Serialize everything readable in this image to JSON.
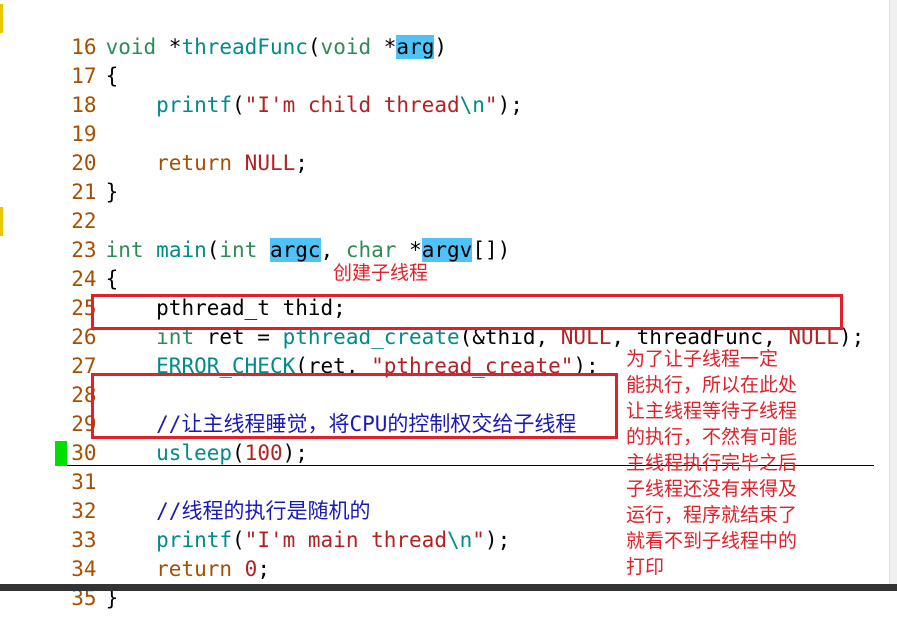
{
  "editor": {
    "lines": [
      {
        "n": "16"
      },
      {
        "n": "17"
      },
      {
        "n": "18"
      },
      {
        "n": "19"
      },
      {
        "n": "20"
      },
      {
        "n": "21"
      },
      {
        "n": "22"
      },
      {
        "n": "23"
      },
      {
        "n": "24"
      },
      {
        "n": "25"
      },
      {
        "n": "26"
      },
      {
        "n": "27"
      },
      {
        "n": "28"
      },
      {
        "n": "29"
      },
      {
        "n": "30"
      },
      {
        "n": "31"
      },
      {
        "n": "32"
      },
      {
        "n": "33"
      },
      {
        "n": "34"
      },
      {
        "n": "35"
      }
    ],
    "code": {
      "l16": {
        "a": "void",
        "b": " *",
        "c": "threadFunc",
        "d": "(",
        "e": "void",
        "f": " *",
        "g": "arg",
        "h": ")"
      },
      "l17": "{",
      "l18": {
        "fn": "printf",
        "open": "(",
        "s1": "\"I'm child thread",
        "esc": "\\n",
        "s2": "\"",
        "close": ");"
      },
      "l20": {
        "kw": "return",
        "sp": " ",
        "null": "NULL",
        "end": ";"
      },
      "l21": "}",
      "l23": {
        "t1": "int",
        "sp1": " ",
        "fn": "main",
        "p1": "(",
        "t2": "int",
        "sp2": " ",
        "a1": "argc",
        "c1": ", ",
        "t3": "char",
        "sp3": " *",
        "a2": "argv",
        "end": "[])"
      },
      "l24": "{",
      "l25": "pthread_t thid;",
      "l26": {
        "t": "int",
        "mid": " ret = ",
        "fn": "pthread_create",
        "a": "(&thid, ",
        "n1": "NULL",
        "b": ", threadFunc, ",
        "n2": "NULL",
        "end": ");"
      },
      "l27": {
        "m": "ERROR_CHECK",
        "a": "(ret, ",
        "s": "\"pthread_create\"",
        "end": ");"
      },
      "l29": "//让主线程睡觉，将CPU的控制权交给子线程",
      "l30": {
        "fn": "usleep",
        "a": "(",
        "num": "100",
        "end": ");"
      },
      "l32": "//线程的执行是随机的",
      "l33": {
        "fn": "printf",
        "open": "(",
        "s1": "\"I'm main thread",
        "esc": "\\n",
        "s2": "\"",
        "close": ");"
      },
      "l34": {
        "kw": "return",
        "sp": " ",
        "num": "0",
        "end": ";"
      },
      "l35": "}"
    }
  },
  "annotations": {
    "create_thread": "创建子线程",
    "explanation": "为了让子线程一定\n能执行，所以在此处\n让主线程等待子线程\n的执行，不然有可能\n主线程执行完毕之后\n子线程还没有来得及\n运行，程序就结束了\n就看不到子线程中的\n打印"
  },
  "colors": {
    "annotation": "#e0202a",
    "highlight": "#4fc3f7",
    "cursor": "#00e000"
  }
}
